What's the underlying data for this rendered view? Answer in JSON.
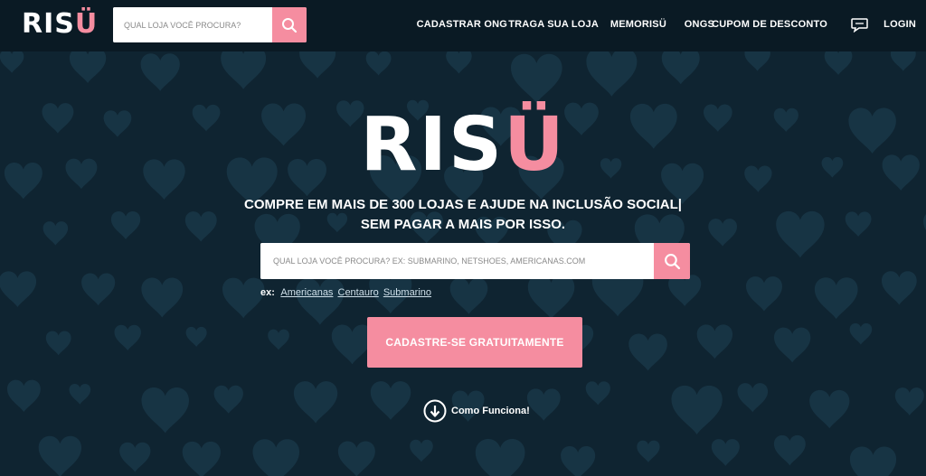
{
  "brand": {
    "logo_main": "RIS",
    "logo_accent": "Ü"
  },
  "colors": {
    "accent": "#f58da0",
    "background": "#0f2431",
    "topbar": "#0a1a24"
  },
  "header": {
    "search": {
      "placeholder": "QUAL LOJA VOCÊ PROCURA?",
      "icon": "search-icon"
    },
    "nav": [
      {
        "label": "CADASTRAR ONG"
      },
      {
        "label": "TRAGA SUA LOJA"
      },
      {
        "label": "MEMORISÜ"
      },
      {
        "label": "ONGS"
      },
      {
        "label": "CUPOM DE DESCONTO"
      },
      {
        "icon": "chat-bubble-icon"
      },
      {
        "label": "LOGIN"
      }
    ]
  },
  "hero": {
    "logo_main": "RIS",
    "logo_accent": "Ü",
    "tagline_line1": "COMPRE EM MAIS DE 300 LOJAS E AJUDE NA INCLUSÃO SOCIAL|",
    "tagline_line2": "SEM PAGAR A MAIS POR ISSO.",
    "search": {
      "placeholder": "QUAL LOJA VOCÊ PROCURA? EX: SUBMARINO, NETSHOES, AMERICANAS.COM",
      "icon": "search-icon"
    },
    "examples_label": "ex:",
    "examples": [
      "Americanas",
      "Centauro",
      "Submarino"
    ],
    "cta_label": "CADASTRE-SE GRATUITAMENTE",
    "how_label": "Como Funciona!",
    "how_icon": "arrow-down-circle-icon"
  }
}
